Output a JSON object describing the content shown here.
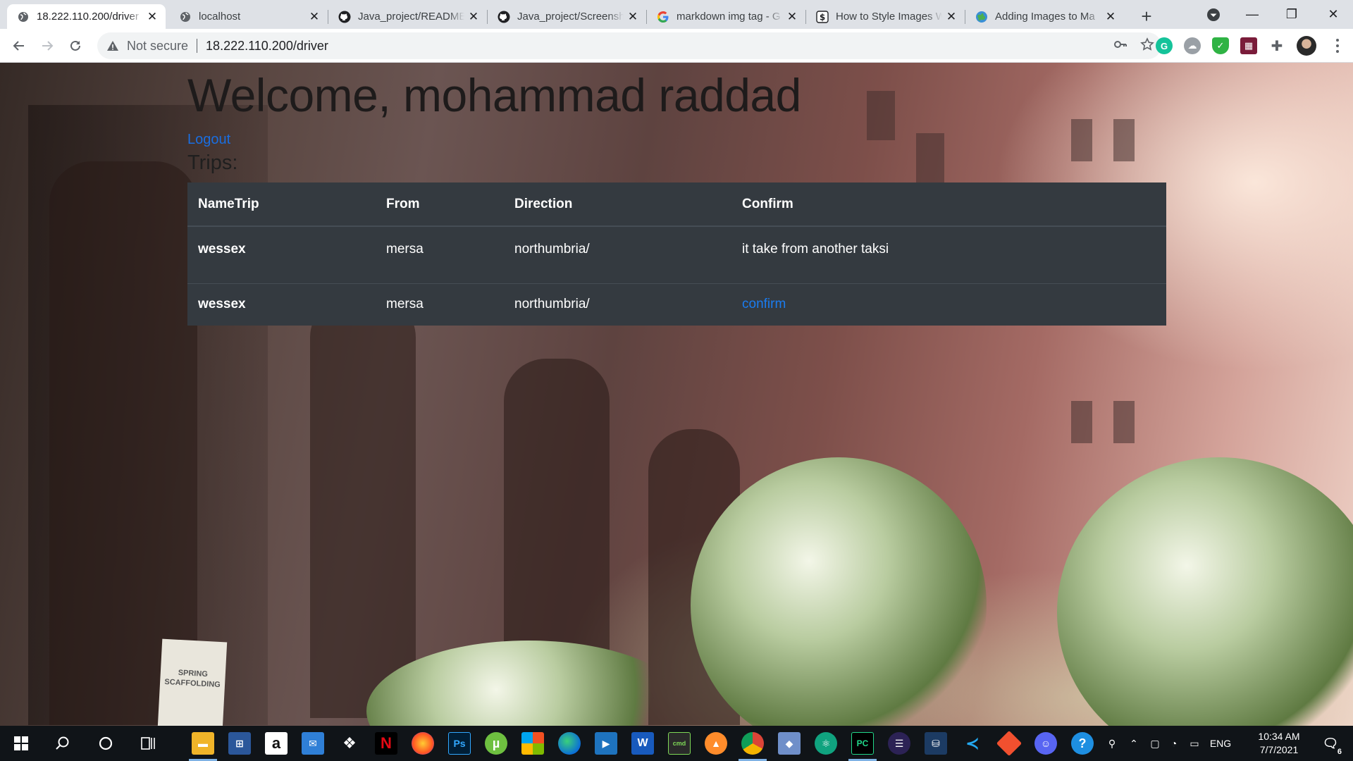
{
  "browser": {
    "tabs": [
      {
        "title": "18.222.110.200/driver",
        "icon": "globe-icon",
        "active": true
      },
      {
        "title": "localhost",
        "icon": "globe-icon",
        "active": false
      },
      {
        "title": "Java_project/README",
        "icon": "github-icon",
        "active": false
      },
      {
        "title": "Java_project/Screensh",
        "icon": "github-icon",
        "active": false
      },
      {
        "title": "markdown img tag - G",
        "icon": "google-icon",
        "active": false
      },
      {
        "title": "How to Style Images W",
        "icon": "site-icon",
        "active": false
      },
      {
        "title": "Adding Images to Ma",
        "icon": "globe-color-icon",
        "active": false
      }
    ],
    "security_label": "Not secure",
    "url": "18.222.110.200/driver"
  },
  "page": {
    "welcome": "Welcome, mohammad raddad",
    "logout": "Logout",
    "trips_heading": "Trips:",
    "table": {
      "headers": [
        "NameTrip",
        "From",
        "Direction",
        "Confirm"
      ],
      "rows": [
        {
          "name": "wessex",
          "from": "mersa",
          "direction": "northumbria/",
          "confirm": "it take from another taksi",
          "confirm_is_link": false
        },
        {
          "name": "wessex",
          "from": "mersa",
          "direction": "northumbria/",
          "confirm": "confirm",
          "confirm_is_link": true
        }
      ]
    },
    "signboard_text": "SPRING SCAFFOLDING"
  },
  "taskbar": {
    "language": "ENG",
    "time": "10:34 AM",
    "date": "7/7/2021",
    "notifications": "6"
  },
  "colors": {
    "table_bg": "#343a40",
    "link": "#1a7cf0",
    "taskbar": "#101418"
  }
}
